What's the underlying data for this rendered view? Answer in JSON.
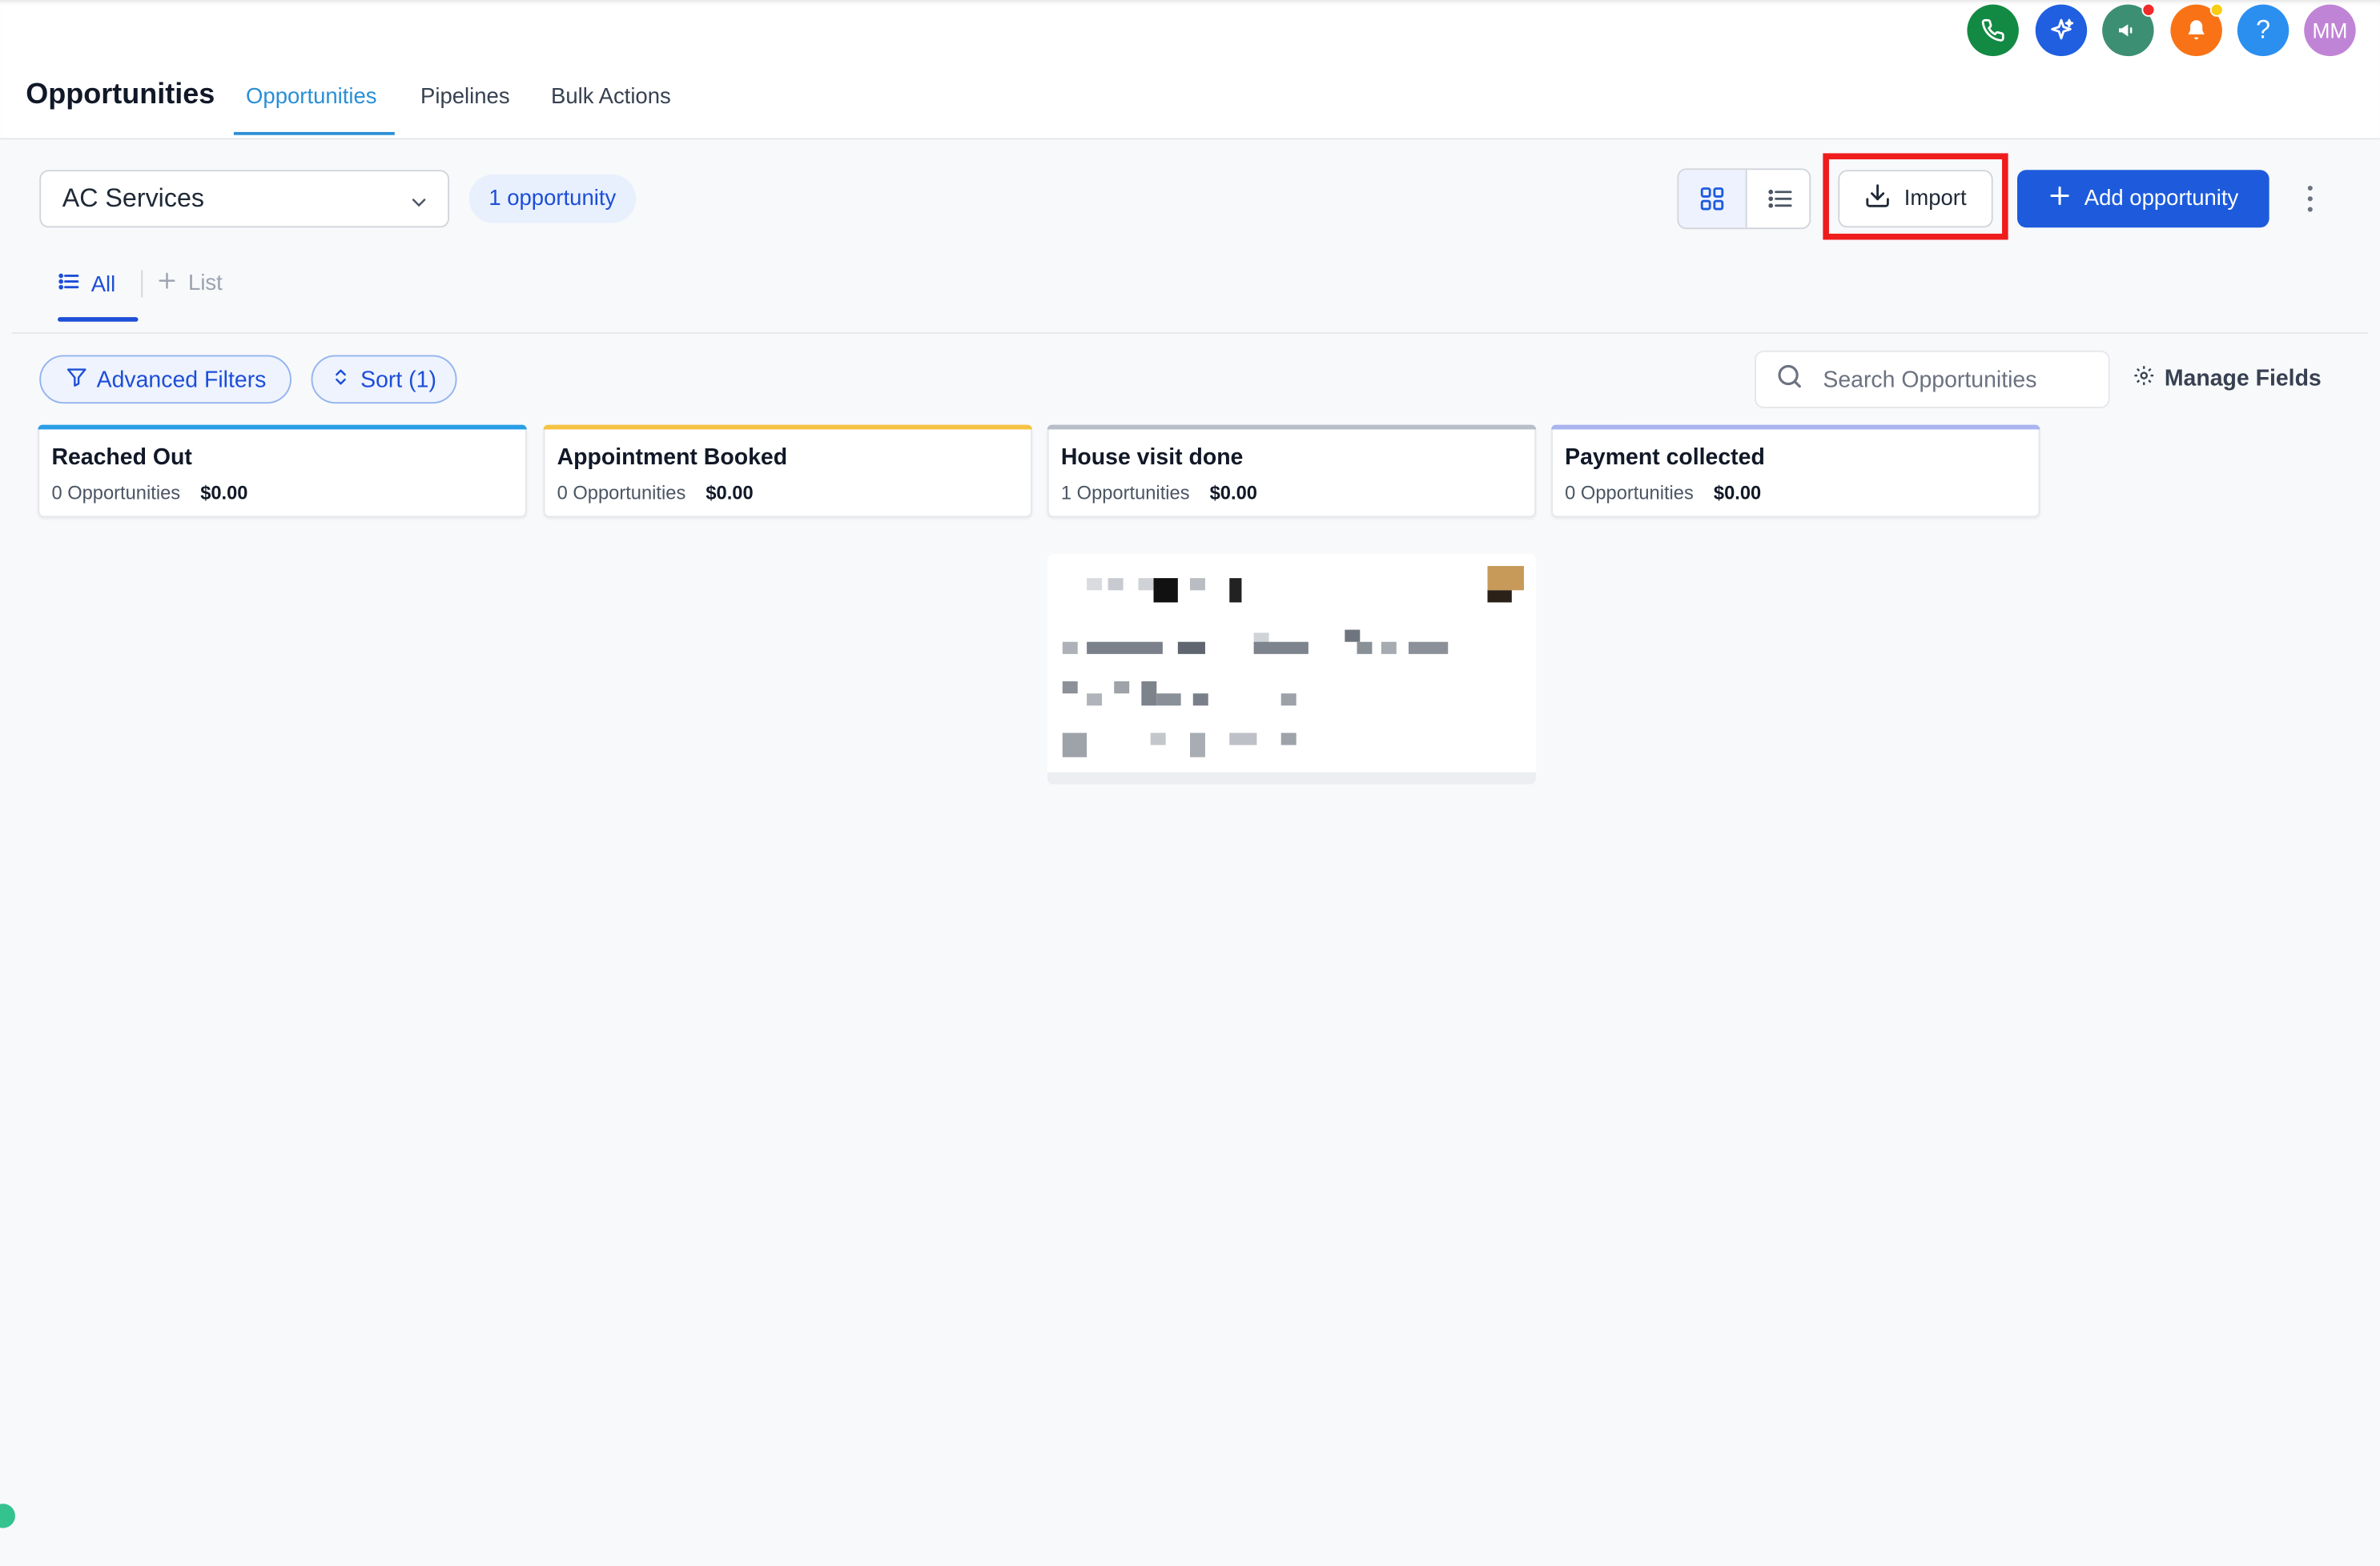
{
  "header": {
    "title": "Opportunities",
    "tabs": [
      {
        "label": "Opportunities",
        "active": true
      },
      {
        "label": "Pipelines",
        "active": false
      },
      {
        "label": "Bulk Actions",
        "active": false
      }
    ],
    "icons": [
      {
        "name": "phone-icon",
        "color": "#138a43"
      },
      {
        "name": "ai-sparkle-icon",
        "color": "#1f5fe0"
      },
      {
        "name": "megaphone-icon",
        "color": "#3d8f74"
      },
      {
        "name": "bell-icon",
        "color": "#f97316"
      },
      {
        "name": "help-icon",
        "color": "#2b8ff0"
      }
    ],
    "avatar_initials": "MM"
  },
  "toolbar": {
    "pipeline_value": "AC Services",
    "count_label": "1 opportunity",
    "import_label": "Import",
    "add_label": "Add opportunity"
  },
  "subtabs": {
    "all_label": "All",
    "list_label": "List"
  },
  "filters": {
    "advanced_label": "Advanced Filters",
    "sort_label": "Sort (1)",
    "search_placeholder": "Search Opportunities",
    "manage_fields_label": "Manage Fields"
  },
  "stages": [
    {
      "name": "Reached Out",
      "count": "0 Opportunities",
      "amount": "$0.00",
      "color": "#2a9ee6"
    },
    {
      "name": "Appointment Booked",
      "count": "0 Opportunities",
      "amount": "$0.00",
      "color": "#f5c242"
    },
    {
      "name": "House visit done",
      "count": "1 Opportunities",
      "amount": "$0.00",
      "color": "#b8bec8"
    },
    {
      "name": "Payment collected",
      "count": "0 Opportunities",
      "amount": "$0.00",
      "color": "#a9b4f0"
    }
  ],
  "colors": {
    "accent": "#1d5bdc",
    "highlight": "#ef1c1c",
    "avatar": "#c084d6"
  }
}
